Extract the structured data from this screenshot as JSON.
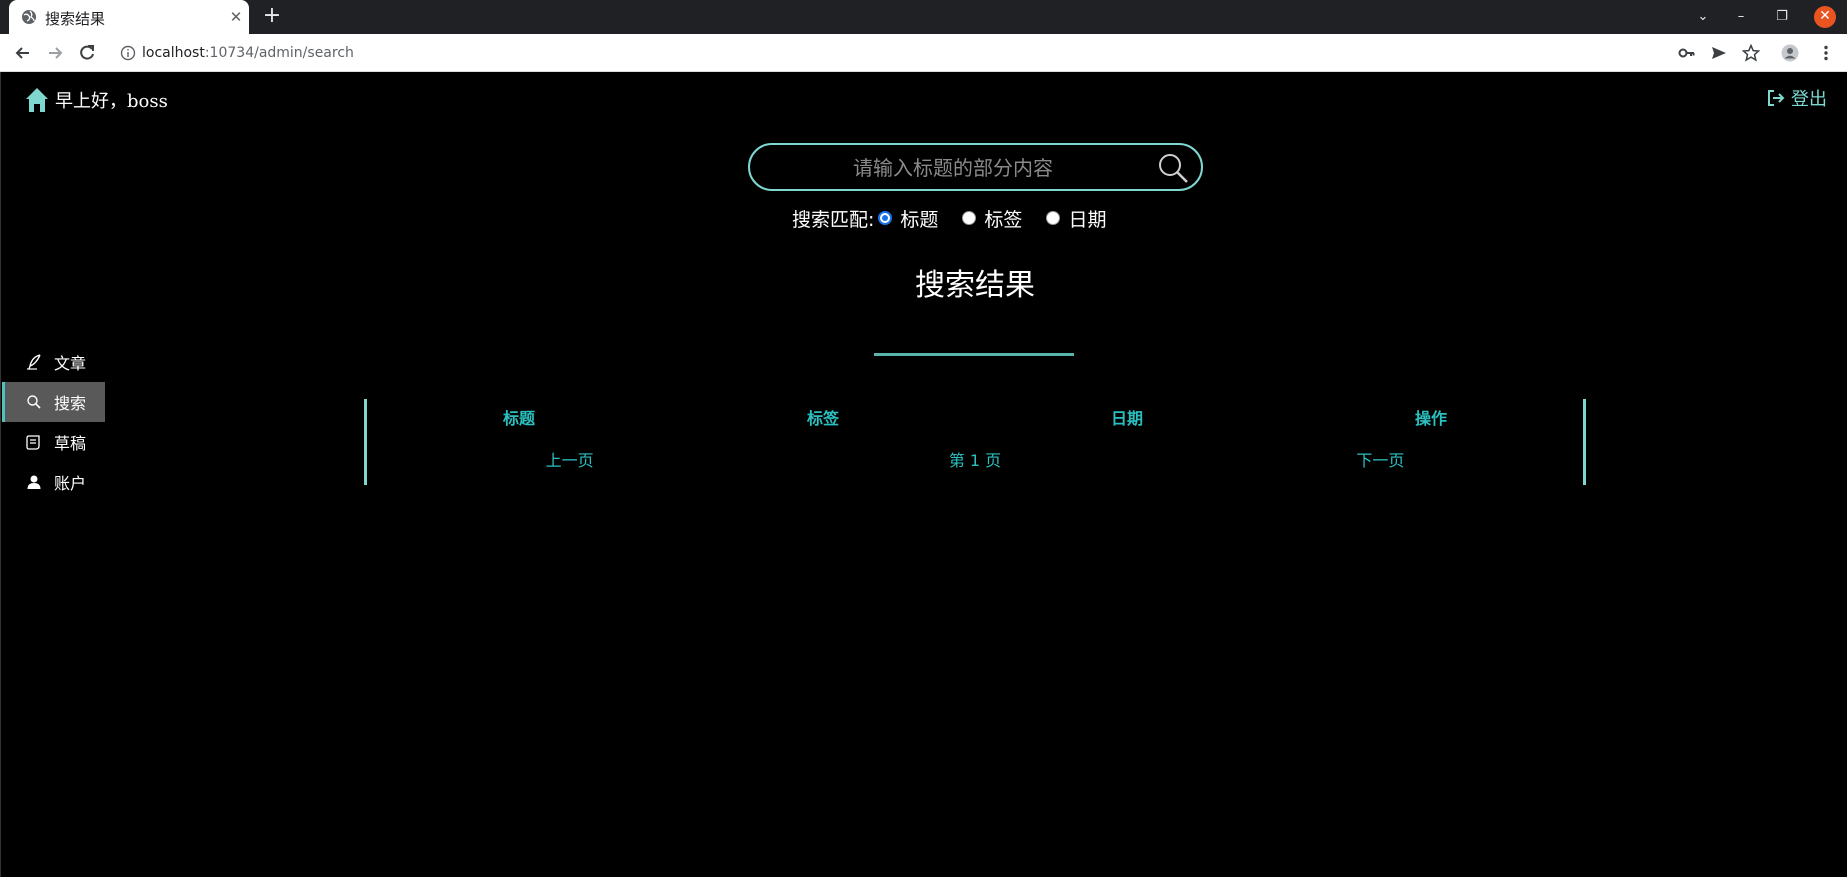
{
  "browser": {
    "tab_title": "搜索结果",
    "url_host": "localhost",
    "url_rest": ":10734/admin/search"
  },
  "header": {
    "greeting": "早上好，boss",
    "logout_label": "登出"
  },
  "search": {
    "placeholder": "请输入标题的部分内容",
    "value": "",
    "match_label": "搜索匹配:",
    "options": [
      "标题",
      "标签",
      "日期"
    ],
    "selected": "标题"
  },
  "results": {
    "title": "搜索结果",
    "columns": [
      "标题",
      "标签",
      "日期",
      "操作"
    ],
    "prev_label": "上一页",
    "page_label": "第 1 页",
    "next_label": "下一页"
  },
  "sidebar": {
    "items": [
      {
        "label": "文章",
        "icon": "quill-icon",
        "active": false
      },
      {
        "label": "搜索",
        "icon": "search-icon",
        "active": true
      },
      {
        "label": "草稿",
        "icon": "scroll-icon",
        "active": false
      },
      {
        "label": "账户",
        "icon": "user-icon",
        "active": false
      }
    ]
  },
  "colors": {
    "accent": "#7fd8d0",
    "table_text": "#2bc0c0",
    "active_bg": "#595959"
  }
}
